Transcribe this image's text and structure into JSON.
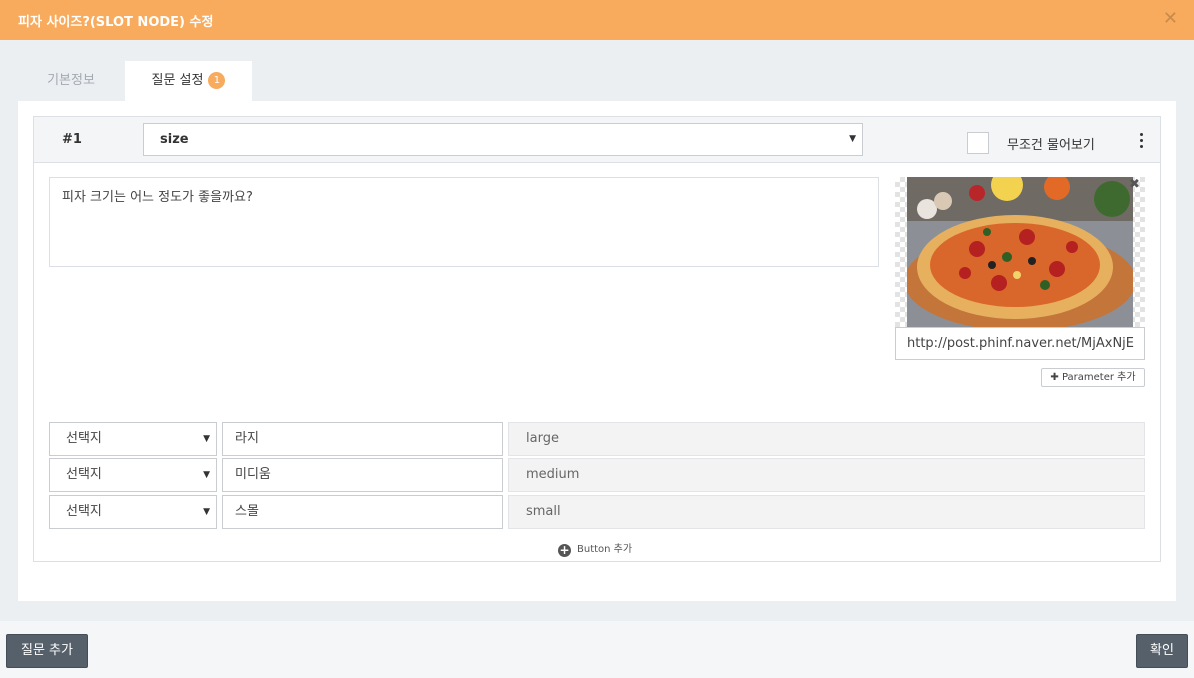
{
  "window": {
    "title": "피자 사이즈?(SLOT NODE) 수정",
    "close_glyph": "✕"
  },
  "tabs": [
    {
      "label": "기본정보"
    },
    {
      "label": "질문 설정",
      "badge": "1"
    }
  ],
  "question": {
    "number": "#1",
    "slot_value": "size",
    "always_ask_label": "무조건 물어보기",
    "always_ask_checked": false,
    "text": "피자 크기는 어느 정도가 좋을까요?",
    "image_url": "http://post.phinf.naver.net/MjAxNjE",
    "param_button_label": "Parameter 추가",
    "buttons": [
      {
        "type": "선택지",
        "label": "라지",
        "value": "large"
      },
      {
        "type": "선택지",
        "label": "미디움",
        "value": "medium"
      },
      {
        "type": "선택지",
        "label": "스몰",
        "value": "small"
      }
    ],
    "add_button_label": "Button 추가"
  },
  "footer": {
    "add_question_label": "질문 추가",
    "confirm_label": "확인"
  },
  "colors": {
    "accent": "#f8ab5c",
    "dark_button": "#56606b"
  }
}
